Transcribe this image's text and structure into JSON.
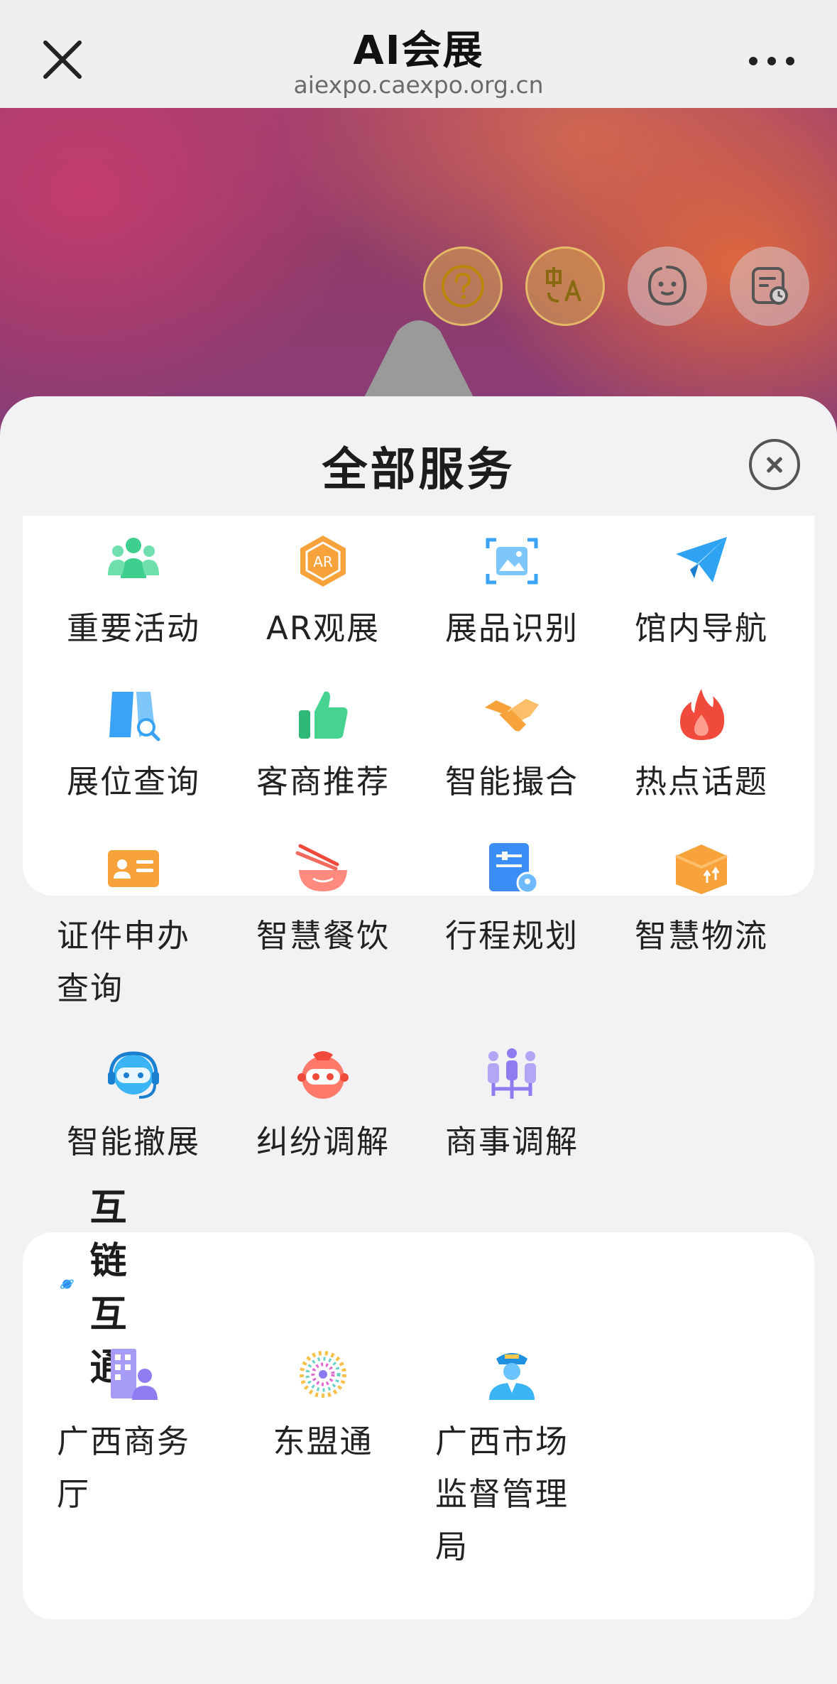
{
  "nav": {
    "title": "AI会展",
    "url": "aiexpo.caexpo.org.cn"
  },
  "hero_buttons": [
    "help-icon",
    "translate-icon",
    "assistant-face-icon",
    "history-icon"
  ],
  "sheet": {
    "title": "全部服务"
  },
  "services": [
    {
      "label": "重要活动",
      "icon": "people-group-icon"
    },
    {
      "label": "AR观展",
      "icon": "ar-hexagon-icon"
    },
    {
      "label": "展品识别",
      "icon": "image-scan-icon"
    },
    {
      "label": "馆内导航",
      "icon": "paper-plane-icon"
    },
    {
      "label": "展位查询",
      "icon": "booth-search-icon"
    },
    {
      "label": "客商推荐",
      "icon": "thumbs-up-icon"
    },
    {
      "label": "智能撮合",
      "icon": "handshake-icon"
    },
    {
      "label": "热点话题",
      "icon": "flame-icon"
    },
    {
      "label": "证件申办查询",
      "icon": "id-card-icon"
    },
    {
      "label": "智慧餐饮",
      "icon": "bowl-chopsticks-icon"
    },
    {
      "label": "行程规划",
      "icon": "itinerary-icon"
    },
    {
      "label": "智慧物流",
      "icon": "package-box-icon"
    },
    {
      "label": "智能撤展",
      "icon": "robot-headset-icon"
    },
    {
      "label": "纠纷调解",
      "icon": "mascot-face-icon"
    },
    {
      "label": "商事调解",
      "icon": "mediation-people-icon"
    }
  ],
  "interlink": {
    "title": "互链互通",
    "items": [
      {
        "label": "广西商务厅",
        "icon": "office-building-icon"
      },
      {
        "label": "东盟通",
        "icon": "dotted-globe-icon"
      },
      {
        "label": "广西市场监督管理局",
        "icon": "officer-icon"
      }
    ]
  },
  "colors": {
    "nav_bg": "#efefef",
    "sheet_bg": "#f2f2f4",
    "card_bg": "#ffffff",
    "green": "#3ecf8e",
    "orange": "#f7a23b",
    "blue": "#3aa3f5",
    "red": "#f04a3d",
    "purple": "#8f7cf0"
  }
}
